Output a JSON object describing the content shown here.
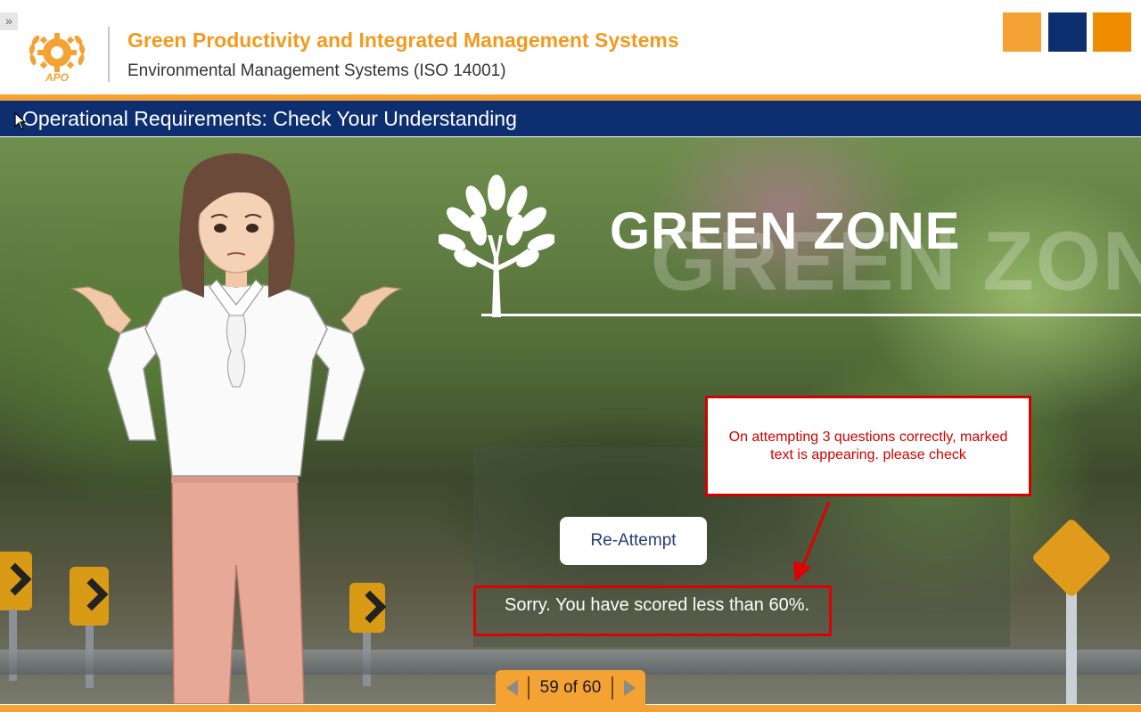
{
  "header": {
    "expand_glyph": "»",
    "logo_label": "APO",
    "course_title": "Green Productivity and Integrated Management Systems",
    "course_subtitle": "Environmental Management Systems (ISO 14001)",
    "corner_squares": [
      {
        "color": "#f4a233"
      },
      {
        "color": "#0e2f6f"
      },
      {
        "color": "#f08c00"
      }
    ]
  },
  "titlebar": {
    "page_title": "Operational Requirements: Check Your Understanding"
  },
  "scene": {
    "banner_title": "GREEN ZONE",
    "banner_shadow_text": "GREEN ZONE",
    "reattempt_label": "Re-Attempt",
    "score_message": "Sorry. You have scored less than 60%."
  },
  "annotation": {
    "note": "On attempting 3 questions correctly, marked text is appearing. please check"
  },
  "nav": {
    "page_counter": "59 of 60"
  },
  "colors": {
    "orange": "#f4a233",
    "navy": "#0e2f6f",
    "annotation_red": "#d40000"
  }
}
